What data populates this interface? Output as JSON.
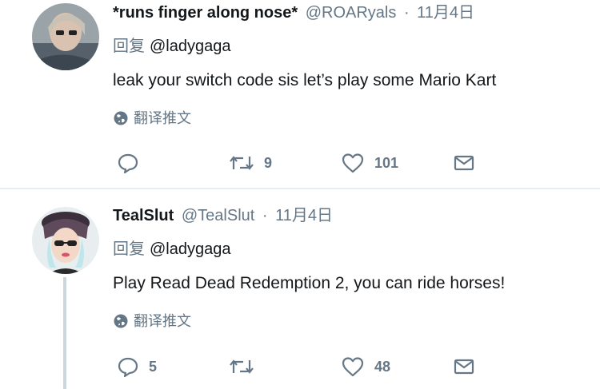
{
  "tweets": [
    {
      "name": "*runs finger along nose*",
      "handle": "@ROARyals",
      "dot": "·",
      "time": "11月4日",
      "reply_prefix": "回复",
      "reply_to": "@ladygaga",
      "text": "leak your switch code sis let’s play some Mario Kart",
      "translate_label": "翻译推文",
      "replies": "",
      "retweets": "9",
      "likes": "101"
    },
    {
      "name": "TealSlut",
      "handle": "@TealSlut",
      "dot": "·",
      "time": "11月4日",
      "reply_prefix": "回复",
      "reply_to": "@ladygaga",
      "text": "Play Read Dead Redemption 2, you can ride horses!",
      "translate_label": "翻译推文",
      "replies": "5",
      "retweets": "",
      "likes": "48"
    }
  ],
  "icons": {
    "reply": "reply-icon",
    "retweet": "retweet-icon",
    "like": "heart-icon",
    "dm": "envelope-icon",
    "translate": "globe-icon"
  },
  "colors": {
    "text": "#14171a",
    "secondary": "#657786",
    "divider": "#e6ecf0",
    "thread_line": "#ccd6dd"
  }
}
